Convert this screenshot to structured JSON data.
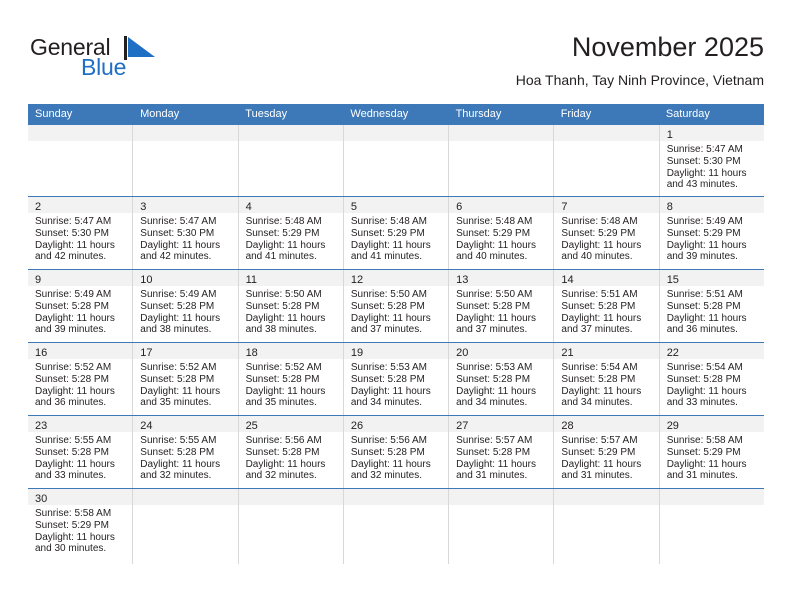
{
  "brand": {
    "name_top": "General",
    "name_bottom": "Blue",
    "flag_icon": "flag-triangle-icon",
    "accent_color": "#1f6fc4"
  },
  "header": {
    "title": "November 2025",
    "subtitle": "Hoa Thanh, Tay Ninh Province, Vietnam"
  },
  "theme": {
    "header_blue": "#3d79b8",
    "daynum_band": "#f2f2f2",
    "text": "#231f20",
    "cell_border": "#d8d8d8"
  },
  "calendar": {
    "weekdays": [
      "Sunday",
      "Monday",
      "Tuesday",
      "Wednesday",
      "Thursday",
      "Friday",
      "Saturday"
    ],
    "weeks": [
      [
        {
          "day": "",
          "lines": []
        },
        {
          "day": "",
          "lines": []
        },
        {
          "day": "",
          "lines": []
        },
        {
          "day": "",
          "lines": []
        },
        {
          "day": "",
          "lines": []
        },
        {
          "day": "",
          "lines": []
        },
        {
          "day": "1",
          "lines": [
            "Sunrise: 5:47 AM",
            "Sunset: 5:30 PM",
            "Daylight: 11 hours",
            "and 43 minutes."
          ]
        }
      ],
      [
        {
          "day": "2",
          "lines": [
            "Sunrise: 5:47 AM",
            "Sunset: 5:30 PM",
            "Daylight: 11 hours",
            "and 42 minutes."
          ]
        },
        {
          "day": "3",
          "lines": [
            "Sunrise: 5:47 AM",
            "Sunset: 5:30 PM",
            "Daylight: 11 hours",
            "and 42 minutes."
          ]
        },
        {
          "day": "4",
          "lines": [
            "Sunrise: 5:48 AM",
            "Sunset: 5:29 PM",
            "Daylight: 11 hours",
            "and 41 minutes."
          ]
        },
        {
          "day": "5",
          "lines": [
            "Sunrise: 5:48 AM",
            "Sunset: 5:29 PM",
            "Daylight: 11 hours",
            "and 41 minutes."
          ]
        },
        {
          "day": "6",
          "lines": [
            "Sunrise: 5:48 AM",
            "Sunset: 5:29 PM",
            "Daylight: 11 hours",
            "and 40 minutes."
          ]
        },
        {
          "day": "7",
          "lines": [
            "Sunrise: 5:48 AM",
            "Sunset: 5:29 PM",
            "Daylight: 11 hours",
            "and 40 minutes."
          ]
        },
        {
          "day": "8",
          "lines": [
            "Sunrise: 5:49 AM",
            "Sunset: 5:29 PM",
            "Daylight: 11 hours",
            "and 39 minutes."
          ]
        }
      ],
      [
        {
          "day": "9",
          "lines": [
            "Sunrise: 5:49 AM",
            "Sunset: 5:28 PM",
            "Daylight: 11 hours",
            "and 39 minutes."
          ]
        },
        {
          "day": "10",
          "lines": [
            "Sunrise: 5:49 AM",
            "Sunset: 5:28 PM",
            "Daylight: 11 hours",
            "and 38 minutes."
          ]
        },
        {
          "day": "11",
          "lines": [
            "Sunrise: 5:50 AM",
            "Sunset: 5:28 PM",
            "Daylight: 11 hours",
            "and 38 minutes."
          ]
        },
        {
          "day": "12",
          "lines": [
            "Sunrise: 5:50 AM",
            "Sunset: 5:28 PM",
            "Daylight: 11 hours",
            "and 37 minutes."
          ]
        },
        {
          "day": "13",
          "lines": [
            "Sunrise: 5:50 AM",
            "Sunset: 5:28 PM",
            "Daylight: 11 hours",
            "and 37 minutes."
          ]
        },
        {
          "day": "14",
          "lines": [
            "Sunrise: 5:51 AM",
            "Sunset: 5:28 PM",
            "Daylight: 11 hours",
            "and 37 minutes."
          ]
        },
        {
          "day": "15",
          "lines": [
            "Sunrise: 5:51 AM",
            "Sunset: 5:28 PM",
            "Daylight: 11 hours",
            "and 36 minutes."
          ]
        }
      ],
      [
        {
          "day": "16",
          "lines": [
            "Sunrise: 5:52 AM",
            "Sunset: 5:28 PM",
            "Daylight: 11 hours",
            "and 36 minutes."
          ]
        },
        {
          "day": "17",
          "lines": [
            "Sunrise: 5:52 AM",
            "Sunset: 5:28 PM",
            "Daylight: 11 hours",
            "and 35 minutes."
          ]
        },
        {
          "day": "18",
          "lines": [
            "Sunrise: 5:52 AM",
            "Sunset: 5:28 PM",
            "Daylight: 11 hours",
            "and 35 minutes."
          ]
        },
        {
          "day": "19",
          "lines": [
            "Sunrise: 5:53 AM",
            "Sunset: 5:28 PM",
            "Daylight: 11 hours",
            "and 34 minutes."
          ]
        },
        {
          "day": "20",
          "lines": [
            "Sunrise: 5:53 AM",
            "Sunset: 5:28 PM",
            "Daylight: 11 hours",
            "and 34 minutes."
          ]
        },
        {
          "day": "21",
          "lines": [
            "Sunrise: 5:54 AM",
            "Sunset: 5:28 PM",
            "Daylight: 11 hours",
            "and 34 minutes."
          ]
        },
        {
          "day": "22",
          "lines": [
            "Sunrise: 5:54 AM",
            "Sunset: 5:28 PM",
            "Daylight: 11 hours",
            "and 33 minutes."
          ]
        }
      ],
      [
        {
          "day": "23",
          "lines": [
            "Sunrise: 5:55 AM",
            "Sunset: 5:28 PM",
            "Daylight: 11 hours",
            "and 33 minutes."
          ]
        },
        {
          "day": "24",
          "lines": [
            "Sunrise: 5:55 AM",
            "Sunset: 5:28 PM",
            "Daylight: 11 hours",
            "and 32 minutes."
          ]
        },
        {
          "day": "25",
          "lines": [
            "Sunrise: 5:56 AM",
            "Sunset: 5:28 PM",
            "Daylight: 11 hours",
            "and 32 minutes."
          ]
        },
        {
          "day": "26",
          "lines": [
            "Sunrise: 5:56 AM",
            "Sunset: 5:28 PM",
            "Daylight: 11 hours",
            "and 32 minutes."
          ]
        },
        {
          "day": "27",
          "lines": [
            "Sunrise: 5:57 AM",
            "Sunset: 5:28 PM",
            "Daylight: 11 hours",
            "and 31 minutes."
          ]
        },
        {
          "day": "28",
          "lines": [
            "Sunrise: 5:57 AM",
            "Sunset: 5:29 PM",
            "Daylight: 11 hours",
            "and 31 minutes."
          ]
        },
        {
          "day": "29",
          "lines": [
            "Sunrise: 5:58 AM",
            "Sunset: 5:29 PM",
            "Daylight: 11 hours",
            "and 31 minutes."
          ]
        }
      ],
      [
        {
          "day": "30",
          "lines": [
            "Sunrise: 5:58 AM",
            "Sunset: 5:29 PM",
            "Daylight: 11 hours",
            "and 30 minutes."
          ]
        },
        {
          "day": "",
          "lines": []
        },
        {
          "day": "",
          "lines": []
        },
        {
          "day": "",
          "lines": []
        },
        {
          "day": "",
          "lines": []
        },
        {
          "day": "",
          "lines": []
        },
        {
          "day": "",
          "lines": []
        }
      ]
    ]
  }
}
